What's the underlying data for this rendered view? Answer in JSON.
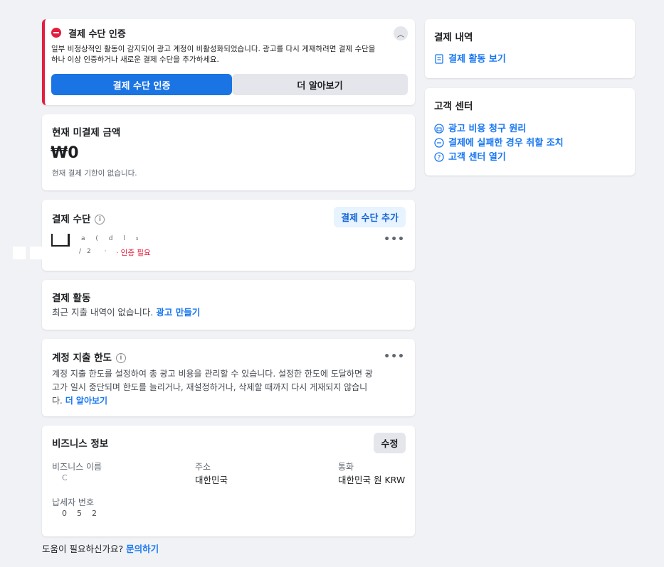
{
  "alert": {
    "title": "결제 수단 인증",
    "body_line1": "일부 비정상적인 활동이 감지되어 광고 계정이 비활성화되었습니다. 광고를 다시 게재하려면 결제 수단을",
    "body_line2": "하나 이상 인증하거나 새로운 결제 수단을 추가하세요.",
    "primary_button": "결제 수단 인증",
    "secondary_button": "더 알아보기",
    "accent_color": "#e41e3f"
  },
  "balance": {
    "title": "현재 미결제 금액",
    "amount": "₩0",
    "note": "현재 결제 기한이 없습니다."
  },
  "payment_methods": {
    "title": "결제 수단",
    "add_button": "결제 수단 추가",
    "status": "· 인증 필요"
  },
  "payment_activity": {
    "title": "결제 활동",
    "text": "최근 지출 내역이 없습니다.",
    "link": "광고 만들기"
  },
  "spending_limit": {
    "title": "계정 지출 한도",
    "line1": "계정 지출 한도를 설정하여 총 광고 비용을 관리할 수 있습니다. 설정한 한도에 도달하면 광",
    "line2": "고가 일시 중단되며 한도를 늘리거나, 재설정하거나, 삭제할 때까지 다시 게재되지 않습니",
    "line3_prefix": "다.",
    "link": "더 알아보기"
  },
  "business_info": {
    "title": "비즈니스 정보",
    "edit_button": "수정",
    "name_label": "비즈니스 이름",
    "name_value": "C",
    "address_label": "주소",
    "address_value": "대한민국",
    "currency_label": "통화",
    "currency_value": "대한민국 원 KRW",
    "tax_label": "납세자 번호",
    "tax_value": "0    5    2"
  },
  "help": {
    "text": "도움이 필요하신가요?",
    "link": "문의하기"
  },
  "billing_history": {
    "title": "결제 내역",
    "link": "결제 활동 보기"
  },
  "help_center": {
    "title": "고객 센터",
    "links": [
      "광고 비용 청구 원리",
      "결제에 실패한 경우 취할 조치",
      "고객 센터 열기"
    ]
  }
}
